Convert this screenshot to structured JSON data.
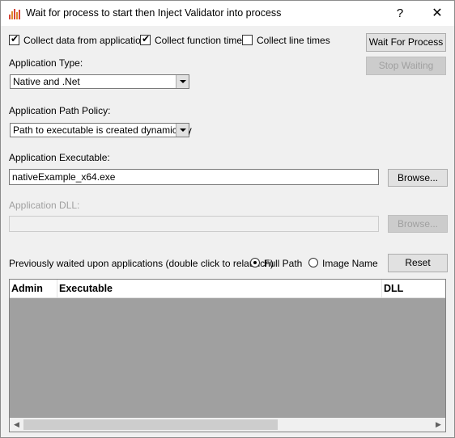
{
  "window": {
    "title": "Wait for process to start then Inject Validator into process",
    "help_label": "?",
    "close_label": "✕"
  },
  "options": {
    "collect_data": {
      "label": "Collect data from application",
      "checked": true
    },
    "collect_function_times": {
      "label": "Collect function times",
      "checked": true
    },
    "collect_line_times": {
      "label": "Collect line times",
      "checked": false
    }
  },
  "buttons": {
    "wait_for_process": "Wait For Process",
    "stop_waiting": "Stop Waiting",
    "browse_exe": "Browse...",
    "browse_dll": "Browse...",
    "reset": "Reset"
  },
  "application_type": {
    "label": "Application Type:",
    "selected": "Native and .Net"
  },
  "path_policy": {
    "label": "Application Path Policy:",
    "selected": "Path to executable is created dynamically"
  },
  "executable": {
    "label": "Application Executable:",
    "value": "nativeExample_x64.exe"
  },
  "dll": {
    "label": "Application DLL:",
    "value": ""
  },
  "history": {
    "label": "Previously waited upon applications (double click to relaunch)",
    "radio_full_path": "Full Path",
    "radio_image_name": "Image Name",
    "selected": "Full Path"
  },
  "table": {
    "columns": [
      "Admin",
      "Executable",
      "DLL"
    ],
    "rows": []
  },
  "scrollbar": {
    "left_arrow": "◀",
    "right_arrow": "▶"
  },
  "tick_glyph": "✔"
}
